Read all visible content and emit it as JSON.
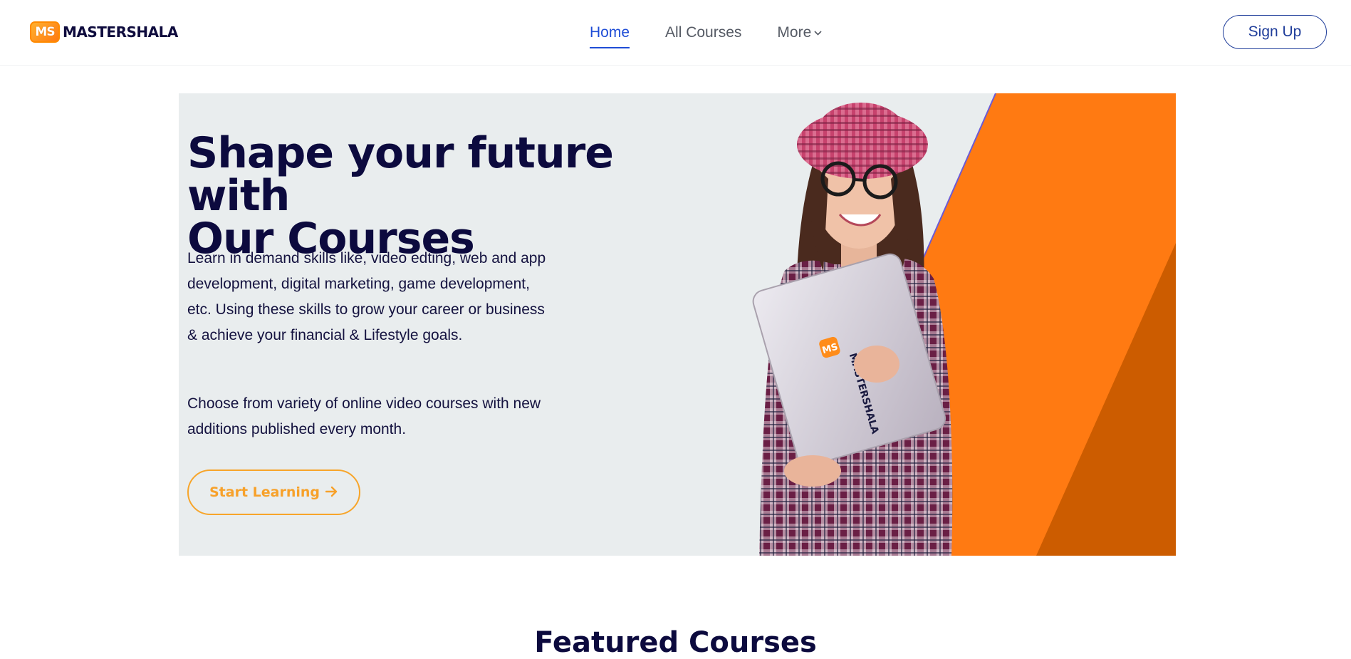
{
  "brand": {
    "badge": "MS",
    "name_part1": "MASTER",
    "name_part2": "SHALA"
  },
  "nav": {
    "items": [
      {
        "label": "Home",
        "active": true
      },
      {
        "label": "All Courses",
        "active": false
      },
      {
        "label": "More",
        "active": false
      }
    ],
    "signup_label": "Sign Up"
  },
  "hero": {
    "title_line1": "Shape your future with",
    "title_line2": "Our Courses",
    "description": "Learn in demand skills like, video edting, web and app development, digital marketing, game development, etc. Using these skills to grow your career or business & achieve your financial & Lifestyle goals.",
    "description2": "Choose from variety of online video courses with new additions published every month.",
    "cta_label": "Start Learning",
    "laptop_badge": "MS",
    "laptop_text": "MASTERSHALA"
  },
  "featured": {
    "heading": "Featured Courses"
  },
  "colors": {
    "primary_blue": "#1f4dd6",
    "navy": "#0c0a3e",
    "orange": "#ff7a12",
    "dark_orange": "#cc5c00",
    "cta_orange": "#f7a12a",
    "hero_bg": "#e9edee"
  },
  "icons": {
    "chevron": "chevron-down-icon",
    "cta_arrow": "arrow-right-icon"
  }
}
